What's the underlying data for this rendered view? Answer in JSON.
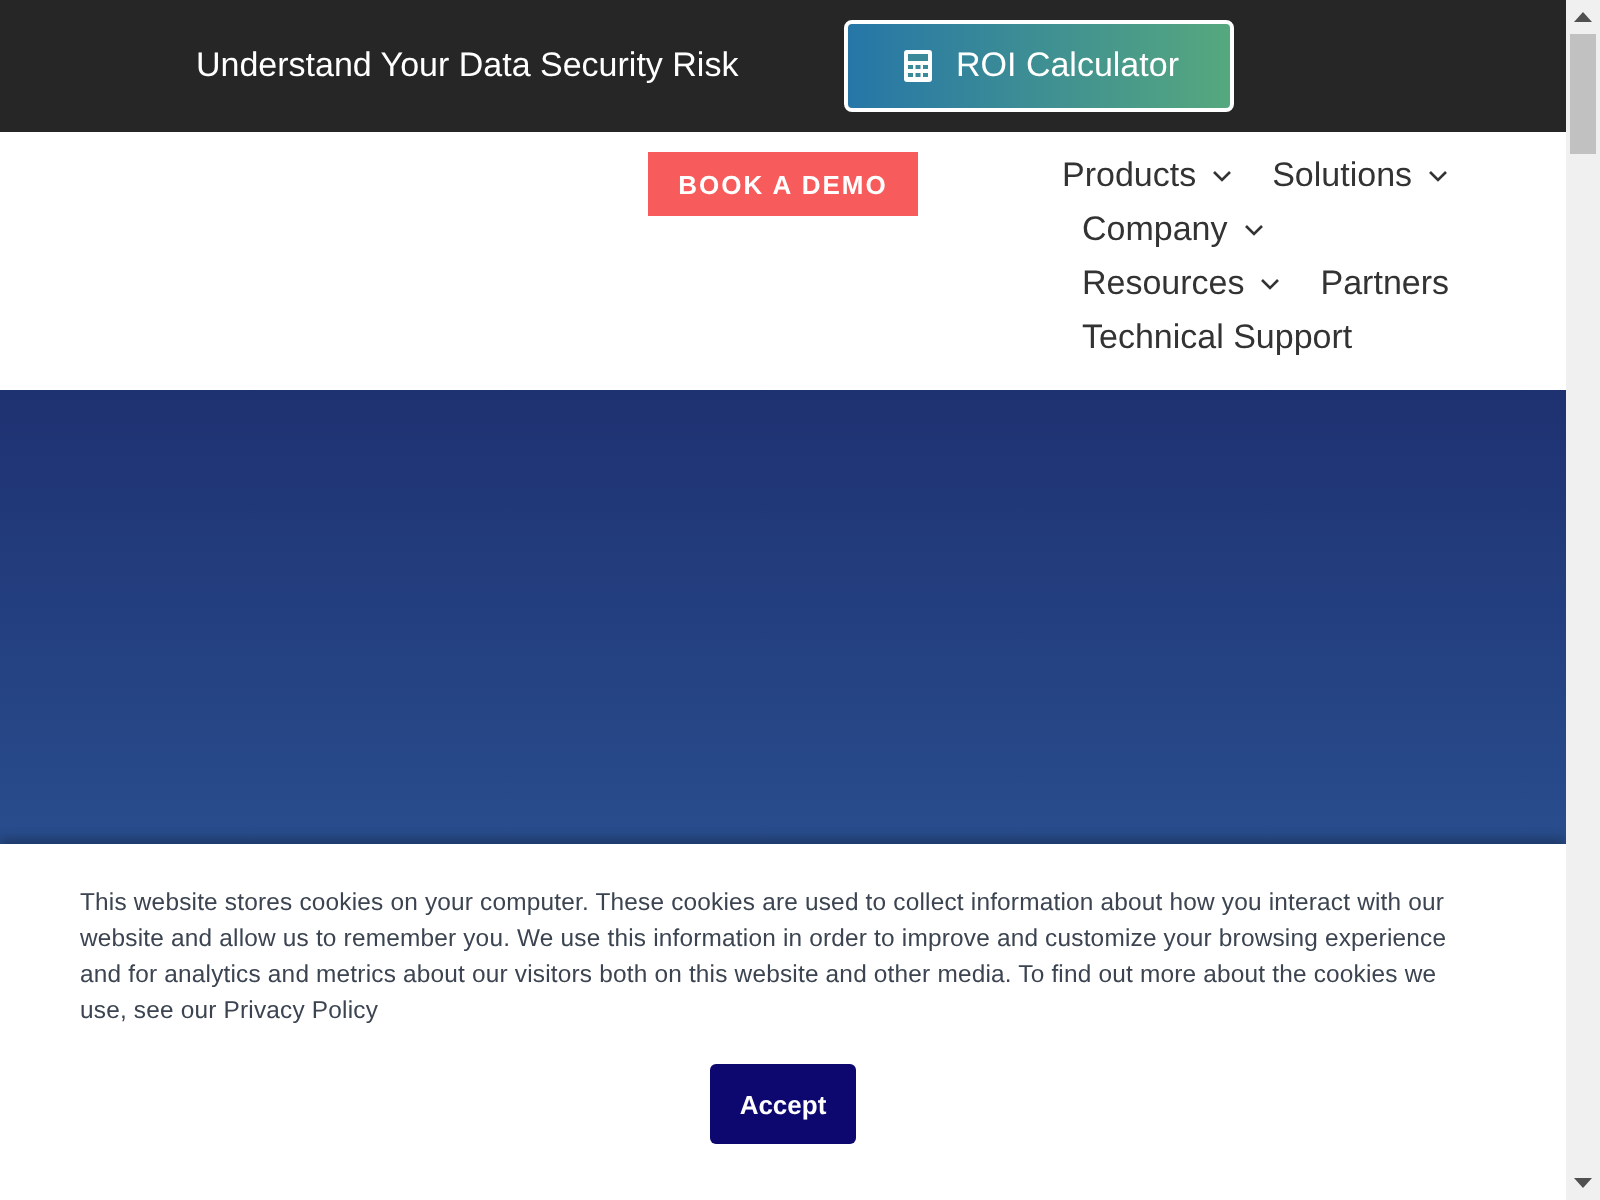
{
  "top_bar": {
    "text": "Understand Your Data Security Risk",
    "button": "ROI Calculator"
  },
  "header": {
    "cta": "BOOK A DEMO",
    "nav": [
      {
        "label": "Products",
        "dropdown": true
      },
      {
        "label": "Solutions",
        "dropdown": true
      },
      {
        "label": "Company",
        "dropdown": true
      },
      {
        "label": "Resources",
        "dropdown": true
      },
      {
        "label": "Partners",
        "dropdown": false
      },
      {
        "label": "Technical Support",
        "dropdown": false
      }
    ]
  },
  "cookie_banner": {
    "text": "This website stores cookies on your computer. These cookies are used to collect information about how you interact with our website and allow us to remember you. We use this information in order to improve and customize your browsing experience and for analytics and metrics about our visitors both on this website and other media. To find out more about the cookies we use, see our Privacy Policy",
    "button": "Accept"
  }
}
